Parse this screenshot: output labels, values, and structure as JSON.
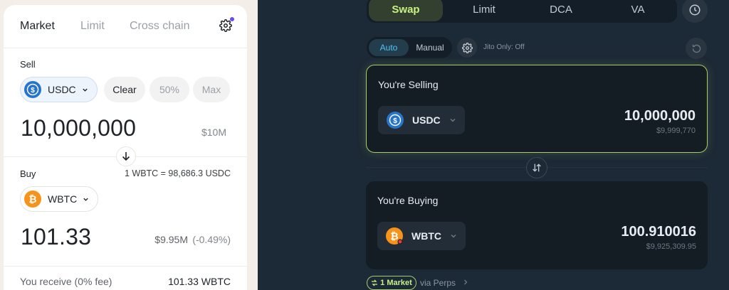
{
  "left": {
    "tabs": [
      "Market",
      "Limit",
      "Cross chain"
    ],
    "sell": {
      "label": "Sell",
      "token": "USDC",
      "chips": [
        "Clear",
        "50%",
        "Max"
      ],
      "amount": "10,000,000",
      "usd": "$10M"
    },
    "rate": "1 WBTC = 98,686.3 USDC",
    "buy": {
      "label": "Buy",
      "token": "WBTC",
      "amount": "101.33",
      "usd": "$9.95M",
      "impact": "(-0.49%)"
    },
    "receive": {
      "label": "You receive (0% fee)",
      "value": "101.33 WBTC"
    }
  },
  "right": {
    "tabs": [
      "Swap",
      "Limit",
      "DCA",
      "VA"
    ],
    "modes": [
      "Auto",
      "Manual"
    ],
    "jito": "Jito Only: Off",
    "sell": {
      "title": "You're Selling",
      "token": "USDC",
      "amount": "10,000,000",
      "usd": "$9,999,770"
    },
    "buy": {
      "title": "You're Buying",
      "token": "WBTC",
      "amount": "100.910016",
      "usd": "$9,925,309.95"
    },
    "route": {
      "badge": "1 Market",
      "via": "via Perps"
    }
  },
  "colors": {
    "accent_lime": "#c7f284",
    "usdc_blue": "#2775ca",
    "btc_orange": "#f7931a",
    "auto_blue": "#4fc3f7",
    "settings_dot": "#6b4cf0"
  },
  "icons": [
    "settings-gear-icon",
    "chevron-down-icon",
    "arrow-down-icon",
    "clock-icon",
    "refresh-icon",
    "swap-vertical-icon",
    "route-icon",
    "chevron-right-icon",
    "usdc-icon",
    "bitcoin-icon"
  ]
}
